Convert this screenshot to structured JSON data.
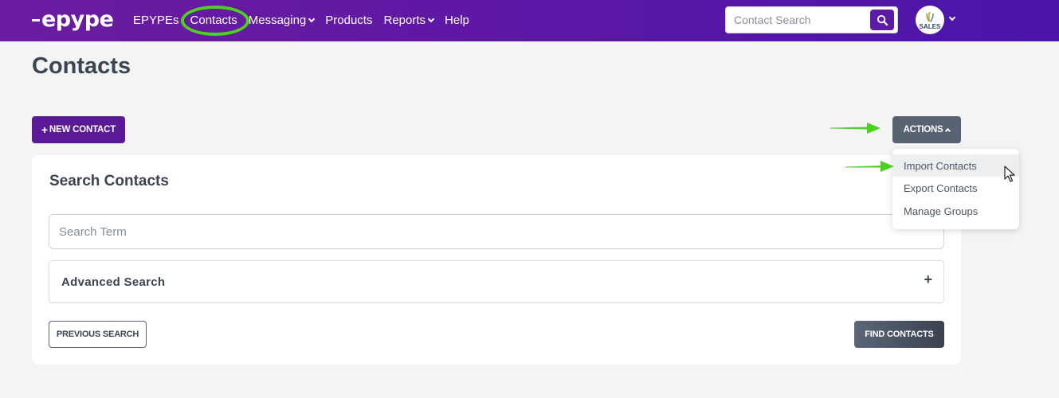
{
  "header": {
    "logo": "epype",
    "nav": [
      {
        "label": "EPYPEs",
        "dropdown": false
      },
      {
        "label": "Contacts",
        "dropdown": false,
        "highlighted": true
      },
      {
        "label": "Messaging",
        "dropdown": true
      },
      {
        "label": "Products",
        "dropdown": false
      },
      {
        "label": "Reports",
        "dropdown": true
      },
      {
        "label": "Help",
        "dropdown": false
      }
    ],
    "search_placeholder": "Contact Search",
    "avatar_label": "SALES"
  },
  "page": {
    "title": "Contacts",
    "new_contact_label": "NEW CONTACT",
    "actions_label": "ACTIONS"
  },
  "actions_menu": {
    "items": [
      "Import Contacts",
      "Export Contacts",
      "Manage Groups"
    ],
    "hovered_index": 0
  },
  "search_card": {
    "title": "Search Contacts",
    "term_placeholder": "Search Term",
    "advanced_label": "Advanced Search",
    "previous_label": "PREVIOUS SEARCH",
    "find_label": "FIND CONTACTS"
  },
  "colors": {
    "brand_purple": "#5a1a98",
    "annotation_green": "#4bd21c",
    "button_slate": "#596273"
  },
  "icons": [
    "search-icon",
    "chevron-down-icon",
    "chevron-up-icon",
    "plus-icon",
    "mouse-cursor-icon",
    "annotation-arrow-icon"
  ]
}
